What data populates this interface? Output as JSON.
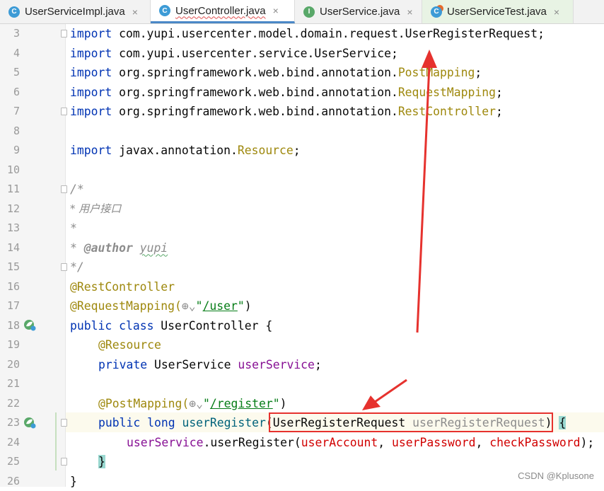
{
  "tabs": [
    {
      "label": "UserServiceImpl.java",
      "icon": "class-icon",
      "active": false
    },
    {
      "label": "UserController.java",
      "icon": "class-icon",
      "active": true
    },
    {
      "label": "UserService.java",
      "icon": "interface-icon",
      "active": false
    },
    {
      "label": "UserServiceTest.java",
      "icon": "test-class-icon",
      "active": false
    }
  ],
  "tab_close_glyph": "×",
  "line_numbers": [
    "3",
    "4",
    "5",
    "6",
    "7",
    "8",
    "9",
    "10",
    "11",
    "12",
    "13",
    "14",
    "15",
    "16",
    "17",
    "18",
    "19",
    "20",
    "21",
    "22",
    "23",
    "24",
    "25",
    "26"
  ],
  "code": {
    "l3": {
      "kw": "import",
      "path": " com.yupi.usercenter.model.domain.request.UserRegisterRequest;"
    },
    "l4": {
      "kw": "import",
      "path": " com.yupi.usercenter.service.UserService;"
    },
    "l5": {
      "kw": "import",
      "pkg": " org.springframework.web.bind.annotation.",
      "cls": "PostMapping",
      "end": ";"
    },
    "l6": {
      "kw": "import",
      "pkg": " org.springframework.web.bind.annotation.",
      "cls": "RequestMapping",
      "end": ";"
    },
    "l7": {
      "kw": "import",
      "pkg": " org.springframework.web.bind.annotation.",
      "cls": "RestController",
      "end": ";"
    },
    "l9": {
      "kw": "import",
      "pkg": " javax.annotation.",
      "cls": "Resource",
      "end": ";"
    },
    "l11": "/*",
    "l12": "* 用户接口",
    "l13": "*",
    "l14": {
      "star": "* ",
      "tag": "@author",
      "name": "yupi"
    },
    "l15": "*/",
    "l16": "@RestController",
    "l17": {
      "ann": "@RequestMapping(",
      "globe": "⊕",
      "chev": "⌄",
      "q1": "\"",
      "path": "/user",
      "q2": "\"",
      "close": ")"
    },
    "l18": {
      "kw1": "public",
      "kw2": "class",
      "name": " UserController {"
    },
    "l19": "@Resource",
    "l20": {
      "kw": "private",
      "type": " UserService ",
      "field": "userService",
      "end": ";"
    },
    "l22": {
      "ann": "@PostMapping(",
      "globe": "⊕",
      "chev": "⌄",
      "q1": "\"",
      "path": "/register",
      "q2": "\"",
      "close": ")"
    },
    "l23": {
      "kw1": "public",
      "kw2": "long",
      "method": " userRegister",
      "paren_open": "(",
      "type": "UserRegisterRequest ",
      "param": "userRegisterRequest",
      "paren_close": ")",
      "brace": "{"
    },
    "l24": {
      "field": "userService",
      "call": ".userRegister(",
      "p1": "userAccount",
      "sep1": ", ",
      "p2": "userPassword",
      "sep2": ", ",
      "p3": "checkPassword",
      "end": ");"
    },
    "l25": "}",
    "l26": "}"
  },
  "watermark": "CSDN @Kplusone",
  "colors": {
    "keyword": "#0033b3",
    "annotation": "#9e880d",
    "string": "#067d17",
    "field": "#871094",
    "param": "#d10000",
    "arrow": "#e6322e"
  }
}
